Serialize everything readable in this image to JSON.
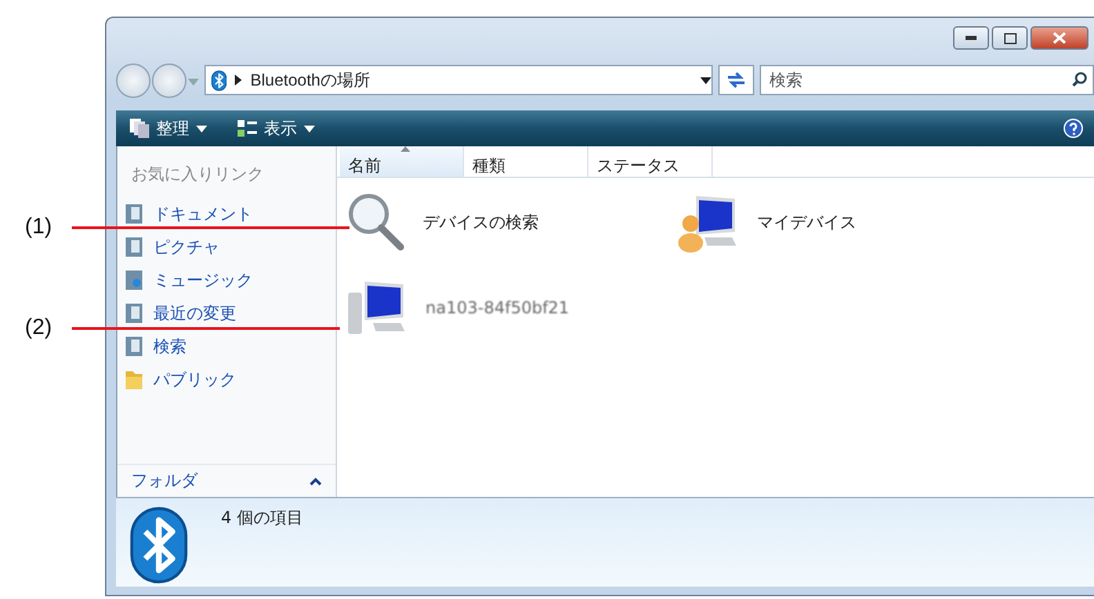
{
  "address_bar": {
    "path": "Bluetoothの場所"
  },
  "search": {
    "placeholder": "検索"
  },
  "toolbar": {
    "items": [
      {
        "label": "整理",
        "kind": "organize"
      },
      {
        "label": "表示",
        "kind": "views"
      }
    ]
  },
  "sidebar": {
    "heading": "お気に入りリンク",
    "items": [
      {
        "label": "ドキュメント",
        "kind": "library"
      },
      {
        "label": "ピクチャ",
        "kind": "library"
      },
      {
        "label": "ミュージック",
        "kind": "music"
      },
      {
        "label": "最近の変更",
        "kind": "library"
      },
      {
        "label": "検索",
        "kind": "library"
      },
      {
        "label": "パブリック",
        "kind": "folder"
      }
    ],
    "folders": {
      "label": "フォルダ",
      "expanded": true
    }
  },
  "table": {
    "columns": [
      {
        "label": "名前",
        "sorted": true
      },
      {
        "label": "種類",
        "sorted": false
      },
      {
        "label": "ステータス",
        "sorted": false
      }
    ]
  },
  "items": [
    {
      "name": "デバイスの検索",
      "kind": "search"
    },
    {
      "name": "マイデバイス",
      "kind": "user-computer"
    },
    {
      "name": "na103-84f50bf21",
      "kind": "computer"
    }
  ],
  "status_bar": {
    "count": "4 個の項目"
  },
  "callouts": [
    {
      "label": "(1)"
    },
    {
      "label": "(2)"
    }
  ]
}
